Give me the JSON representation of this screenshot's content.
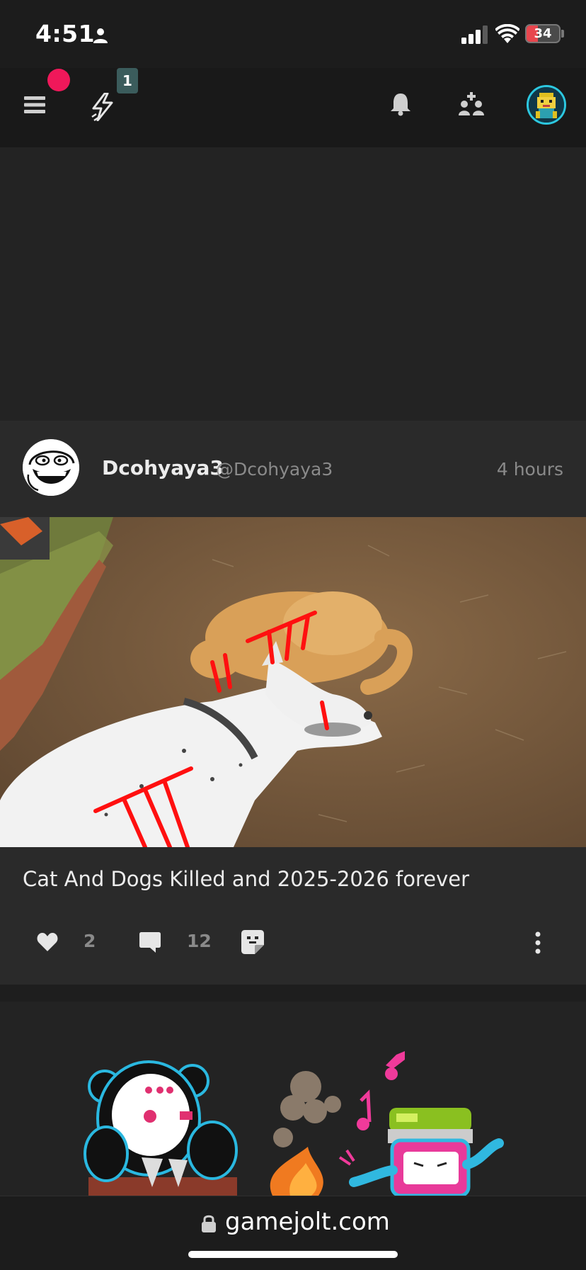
{
  "status_bar": {
    "time": "4:51",
    "battery_level": "34",
    "battery_fraction": 0.34,
    "battery_color": "#e8464e"
  },
  "topnav": {
    "menu_icon": "hamburger-menu-icon",
    "notification_dot_color": "#f0185a",
    "quest_badge_count": "1",
    "icons": [
      "bolt-icon",
      "bell-icon",
      "friends-icon",
      "user-avatar"
    ]
  },
  "post": {
    "author_name": "Dcohyaya3",
    "author_handle": "@Dcohyaya3",
    "time_ago": "4 hours",
    "text": "Cat And Dogs Killed and 2025-2026 forever",
    "like_count": "2",
    "comment_count": "12",
    "actions": [
      "like-icon",
      "comment-icon",
      "sticker-icon",
      "more-options-icon"
    ]
  },
  "browser": {
    "url": "gamejolt.com"
  },
  "colors": {
    "background": "#232323",
    "post_background": "#2a2a2a",
    "nav_background": "#191919",
    "muted_text": "#8a8a8a",
    "avatar_ring": "#2cc8e0"
  }
}
